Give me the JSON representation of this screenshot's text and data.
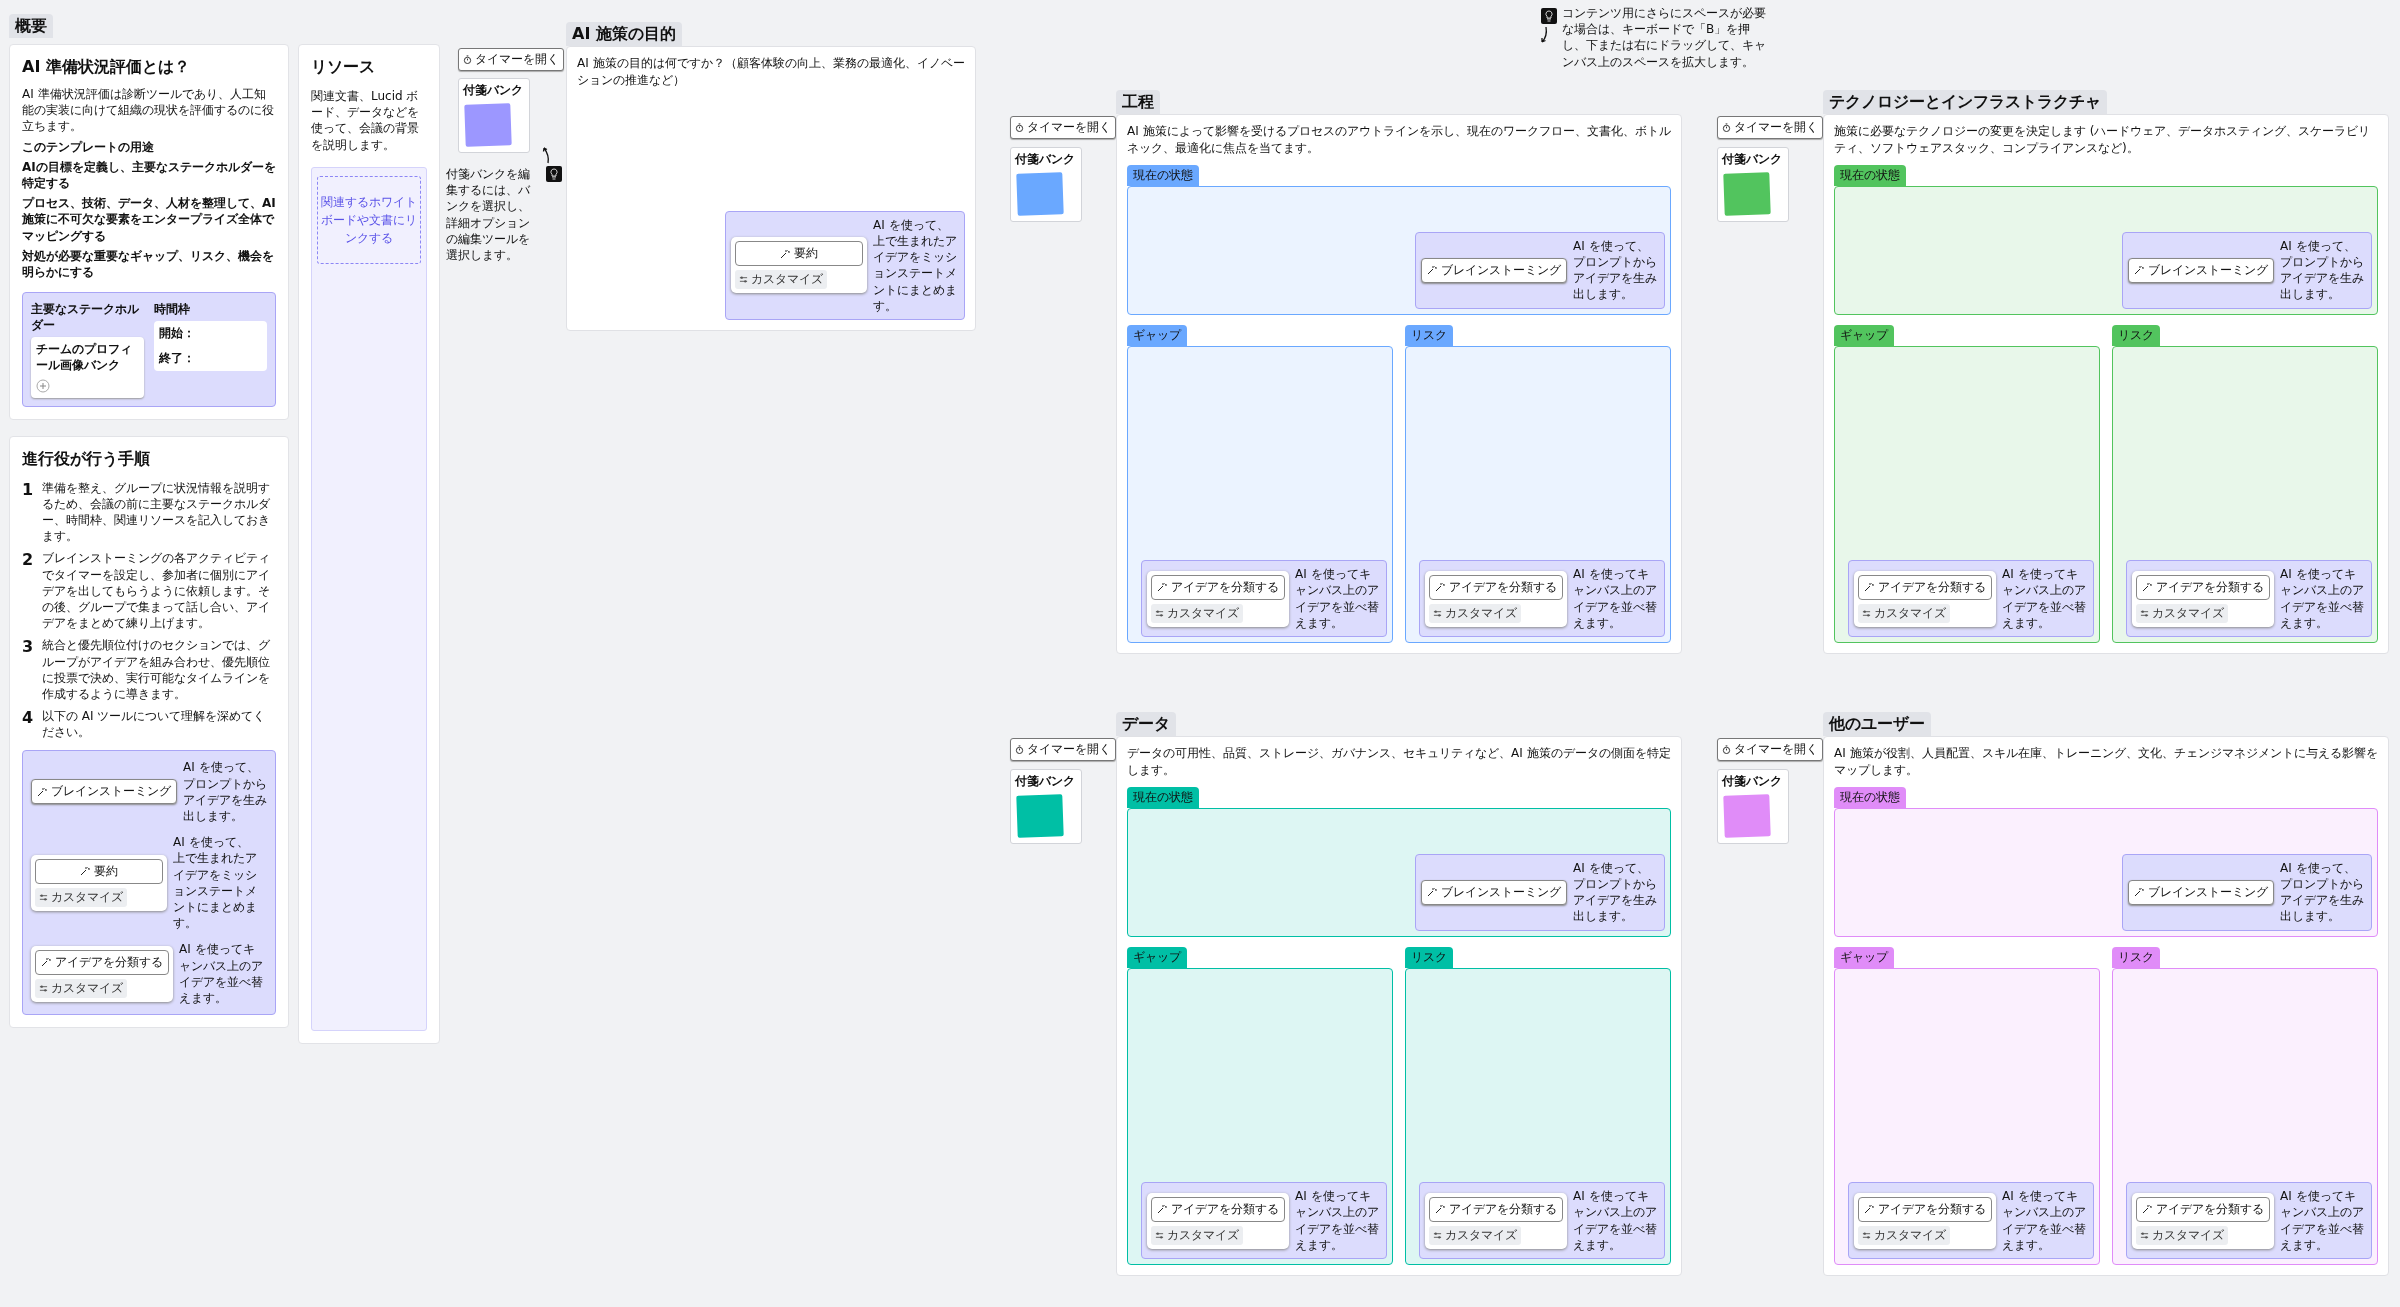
{
  "overview": {
    "tag": "概要",
    "title": "AI 準備状況評価とは？",
    "intro": "AI 準備状況評価は診断ツールであり、人工知能の実装に向けて組織の現状を評価するのに役立ちます。",
    "usage_heading": "このテンプレートの用途",
    "usage_items": [
      "AIの目標を定義し、主要なステークホルダーを特定する",
      "プロセス、技術、データ、人材を整理して、AI 施策に不可欠な要素をエンタープライズ全体でマッピングする",
      "対処が必要な重要なギャップ、リスク、機会を明らかにする"
    ],
    "stakeholders": {
      "label": "主要なステークホルダー",
      "bank": "チームのプロフィール画像バンク"
    },
    "timeframe": {
      "label": "時間枠",
      "start": "開始：",
      "end": "終了："
    }
  },
  "resources": {
    "title": "リソース",
    "text": "関連文書、Lucid ボード、データなどを使って、会議の背景を説明します。",
    "link": "関連するホワイトボードや文書にリンクする"
  },
  "steps": {
    "title": "進行役が行う手順",
    "items": [
      {
        "number": "1",
        "text": "準備を整え、グループに状況情報を説明するため、会議の前に主要なステークホルダー、時間枠、関連リソースを記入しておきます。"
      },
      {
        "number": "2",
        "text": "ブレインストーミングの各アクティビティでタイマーを設定し、参加者に個別にアイデアを出してもらうように依頼します。その後、グループで集まって話し合い、アイデアをまとめて練り上げます。"
      },
      {
        "number": "3",
        "text": "統合と優先順位付けのセクションでは、グループがアイデアを組み合わせ、優先順位に投票で決め、実行可能なタイムラインを作成するように導きます。"
      },
      {
        "number": "4",
        "text": "以下の AI ツールについて理解を深めてください。"
      }
    ],
    "tools": [
      {
        "kind": "button",
        "button": "ブレインストーミング",
        "text": "AI を使って、プロンプトからアイデアを生み出します。"
      },
      {
        "kind": "card",
        "button": "要約",
        "customize": "カスタマイズ",
        "text": "AI を使って、上で生まれたアイデアをミッションステートメントにまとめます。"
      },
      {
        "kind": "card",
        "button": "アイデアを分類する",
        "customize": "カスタマイズ",
        "text": "AI を使ってキャンバス上のアイデアを並べ替えます。"
      }
    ]
  },
  "purpose": {
    "title": "AI 施策の目的",
    "timer": "タイマーを開く",
    "bank": "付箋バンク",
    "color": "#9c97ff",
    "hint": "付箋バンクを編集するには、バンクを選択し、詳細オプションの編集ツールを選択します。",
    "question": "AI 施策の目的は何ですか？（顧客体験の向上、業務の最適化、イノベーションの推進など）",
    "tool": {
      "kind": "card",
      "button": "要約",
      "customize": "カスタマイズ",
      "text": "AI を使って、上で生まれたアイデアをミッションステートメントにまとめます。"
    }
  },
  "canvas_hint": "コンテンツ用にさらにスペースが必要な場合は、キーボードで「B」を押し、下または右にドラッグして、キャンバス上のスペースを拡大します。",
  "sections": [
    {
      "title": "工程",
      "color": "#6aa8ff",
      "timer": "タイマーを開く",
      "bank": "付箋バンク",
      "description": "AI 施策によって影響を受けるプロセスのアウトラインを示し、現在のワークフロー、文書化、ボトルネック、最適化に焦点を当てます。",
      "areas": [
        {
          "label": "現在の状態",
          "tool": {
            "kind": "button",
            "button": "ブレインストーミング",
            "text": "AI を使って、プロンプトからアイデアを生み出します。"
          }
        },
        {
          "label": "ギャップ",
          "tool": {
            "kind": "card",
            "button": "アイデアを分類する",
            "customize": "カスタマイズ",
            "text": "AI を使ってキャンバス上のアイデアを並べ替えます。"
          }
        },
        {
          "label": "リスク",
          "tool": {
            "kind": "card",
            "button": "アイデアを分類する",
            "customize": "カスタマイズ",
            "text": "AI を使ってキャンバス上のアイデアを並べ替えます。"
          }
        }
      ]
    },
    {
      "title": "テクノロジーとインフラストラクチャ",
      "color": "#52c45e",
      "timer": "タイマーを開く",
      "bank": "付箋バンク",
      "description": "施策に必要なテクノロジーの変更を決定します (ハードウェア、データホスティング、スケーラビリティ、ソフトウェアスタック、コンプライアンスなど)。",
      "areas": [
        {
          "label": "現在の状態",
          "tool": {
            "kind": "button",
            "button": "ブレインストーミング",
            "text": "AI を使って、プロンプトからアイデアを生み出します。"
          }
        },
        {
          "label": "ギャップ",
          "tool": {
            "kind": "card",
            "button": "アイデアを分類する",
            "customize": "カスタマイズ",
            "text": "AI を使ってキャンバス上のアイデアを並べ替えます。"
          }
        },
        {
          "label": "リスク",
          "tool": {
            "kind": "card",
            "button": "アイデアを分類する",
            "customize": "カスタマイズ",
            "text": "AI を使ってキャンバス上のアイデアを並べ替えます。"
          }
        }
      ]
    },
    {
      "title": "データ",
      "color": "#00bfa5",
      "timer": "タイマーを開く",
      "bank": "付箋バンク",
      "description": "データの可用性、品質、ストレージ、ガバナンス、セキュリティなど、AI 施策のデータの側面を特定します。",
      "areas": [
        {
          "label": "現在の状態",
          "tool": {
            "kind": "button",
            "button": "ブレインストーミング",
            "text": "AI を使って、プロンプトからアイデアを生み出します。"
          }
        },
        {
          "label": "ギャップ",
          "tool": {
            "kind": "card",
            "button": "アイデアを分類する",
            "customize": "カスタマイズ",
            "text": "AI を使ってキャンバス上のアイデアを並べ替えます。"
          }
        },
        {
          "label": "リスク",
          "tool": {
            "kind": "card",
            "button": "アイデアを分類する",
            "customize": "カスタマイズ",
            "text": "AI を使ってキャンバス上のアイデアを並べ替えます。"
          }
        }
      ]
    },
    {
      "title": "他のユーザー",
      "color": "#e08cf8",
      "timer": "タイマーを開く",
      "bank": "付箋バンク",
      "description": "AI 施策が役割、人員配置、スキル在庫、トレーニング、文化、チェンジマネジメントに与える影響をマップします。",
      "areas": [
        {
          "label": "現在の状態",
          "tool": {
            "kind": "button",
            "button": "ブレインストーミング",
            "text": "AI を使って、プロンプトからアイデアを生み出します。"
          }
        },
        {
          "label": "ギャップ",
          "tool": {
            "kind": "card",
            "button": "アイデアを分類する",
            "customize": "カスタマイズ",
            "text": "AI を使ってキャンバス上のアイデアを並べ替えます。"
          }
        },
        {
          "label": "リスク",
          "tool": {
            "kind": "card",
            "button": "アイデアを分類する",
            "customize": "カスタマイズ",
            "text": "AI を使ってキャンバス上のアイデアを並べ替えます。"
          }
        }
      ]
    }
  ]
}
